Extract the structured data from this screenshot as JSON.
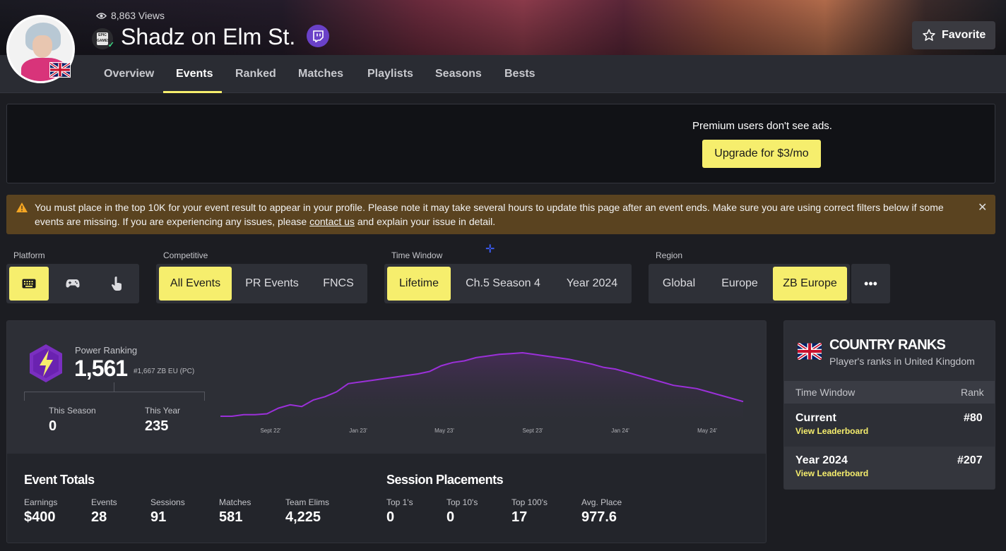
{
  "profile": {
    "views": "8,863 Views",
    "name": "Shadz on Elm St.",
    "favorite_label": "Favorite"
  },
  "tabs": [
    "Overview",
    "Events",
    "Ranked",
    "Matches",
    "Playlists",
    "Seasons",
    "Bests"
  ],
  "active_tab": "Events",
  "ad": {
    "text": "Premium users don't see ads.",
    "button": "Upgrade for $3/mo"
  },
  "warning": {
    "text_before": "You must place in the top 10K for your event result to appear in your profile. Please note it may take several hours to update this page after an event ends. Make sure you are using correct filters below if some events are missing. If you are experiencing any issues, please ",
    "link": "contact us",
    "text_after": " and explain your issue in detail.",
    "close": "✕"
  },
  "filters": {
    "platform": {
      "label": "Platform",
      "options": [
        "keyboard-icon",
        "gamepad-icon",
        "touch-icon"
      ],
      "selected": "keyboard-icon"
    },
    "competitive": {
      "label": "Competitive",
      "options": [
        "All Events",
        "PR Events",
        "FNCS"
      ],
      "selected": "All Events"
    },
    "time_window": {
      "label": "Time Window",
      "options": [
        "Lifetime",
        "Ch.5 Season 4",
        "Year 2024"
      ],
      "selected": "Lifetime"
    },
    "region": {
      "label": "Region",
      "options": [
        "Global",
        "Europe",
        "ZB Europe"
      ],
      "selected": "ZB Europe",
      "more": "•••"
    }
  },
  "power_ranking": {
    "label": "Power Ranking",
    "value": "1,561",
    "sub": "#1,667 ZB EU (PC)",
    "this_season_label": "This Season",
    "this_season_value": "0",
    "this_year_label": "This Year",
    "this_year_value": "235"
  },
  "chart_data": {
    "type": "area",
    "x_tick_labels": [
      "Sept 22'",
      "Jan 23'",
      "May 23'",
      "Sept 23'",
      "Jan 24'",
      "May 24'"
    ],
    "color": "#9b30d9",
    "grid": false,
    "values": [
      0,
      0,
      2,
      2,
      3,
      10,
      14,
      12,
      20,
      24,
      30,
      40,
      42,
      44,
      46,
      48,
      50,
      52,
      55,
      62,
      66,
      68,
      72,
      74,
      76,
      77,
      78,
      76,
      74,
      72,
      70,
      67,
      64,
      60,
      58,
      54,
      50,
      46,
      42,
      38,
      36,
      34,
      30,
      26,
      22,
      18
    ]
  },
  "event_totals": {
    "title": "Event Totals",
    "stats": [
      {
        "label": "Earnings",
        "value": "$400"
      },
      {
        "label": "Events",
        "value": "28"
      },
      {
        "label": "Sessions",
        "value": "91"
      },
      {
        "label": "Matches",
        "value": "581"
      },
      {
        "label": "Team Elims",
        "value": "4,225"
      }
    ]
  },
  "session_placements": {
    "title": "Session Placements",
    "stats": [
      {
        "label": "Top 1's",
        "value": "0"
      },
      {
        "label": "Top 10's",
        "value": "0"
      },
      {
        "label": "Top 100's",
        "value": "17"
      },
      {
        "label": "Avg. Place",
        "value": "977.6"
      }
    ]
  },
  "country_ranks": {
    "title": "COUNTRY RANKS",
    "subtitle": "Player's ranks in United Kingdom",
    "col_window": "Time Window",
    "col_rank": "Rank",
    "rows": [
      {
        "name": "Current",
        "link": "View Leaderboard",
        "rank": "#80"
      },
      {
        "name": "Year 2024",
        "link": "View Leaderboard",
        "rank": "#207"
      }
    ]
  }
}
